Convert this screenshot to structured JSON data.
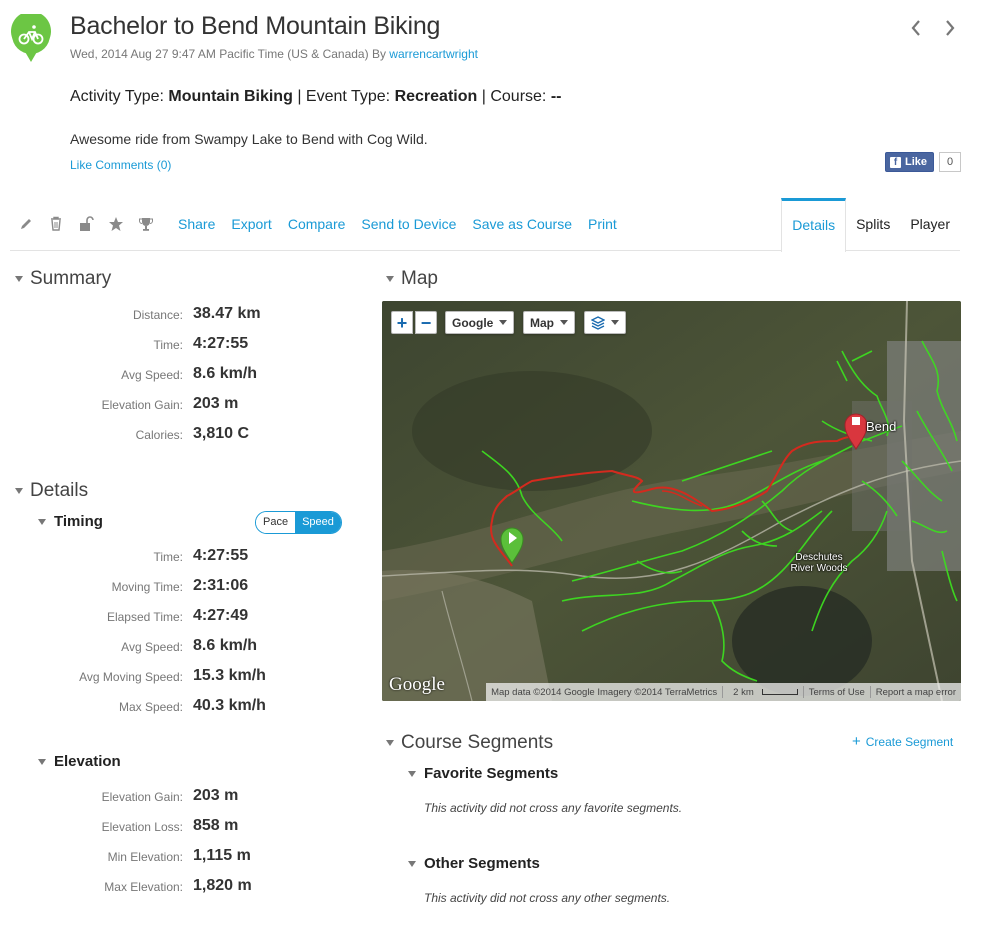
{
  "header": {
    "title": "Bachelor to Bend Mountain Biking",
    "date": "Wed, 2014 Aug 27 9:47 AM Pacific Time (US & Canada) By",
    "user": "warrencartwright",
    "activity_label": "Activity Type:",
    "activity_type": "Mountain Biking",
    "event_label": "| Event Type:",
    "event_type": "Recreation",
    "course_label": "| Course:",
    "course_value": "--",
    "description": "Awesome ride from Swampy Lake to Bend with Cog Wild.",
    "like": "Like",
    "comments": "Comments (0)",
    "accent_color": "#6cc644"
  },
  "facebook": {
    "like_label": "Like",
    "count": "0",
    "icon": "f"
  },
  "toolbar": {
    "icons": [
      "pencil-icon",
      "trash-icon",
      "lock-icon",
      "star-icon",
      "trophy-icon"
    ],
    "links": [
      "Share",
      "Export",
      "Compare",
      "Send to Device",
      "Save as Course",
      "Print"
    ],
    "tabs": [
      "Details",
      "Splits",
      "Player"
    ],
    "active_tab": "Details",
    "link_color": "#1a9ad6"
  },
  "summary": {
    "heading": "Summary",
    "stats": [
      {
        "label": "Distance:",
        "value": "38.47 km"
      },
      {
        "label": "Time:",
        "value": "4:27:55"
      },
      {
        "label": "Avg Speed:",
        "value": "8.6 km/h"
      },
      {
        "label": "Elevation Gain:",
        "value": "203 m"
      },
      {
        "label": "Calories:",
        "value": "3,810 C"
      }
    ]
  },
  "details": {
    "heading": "Details",
    "timing": {
      "heading": "Timing",
      "toggle": {
        "pace": "Pace",
        "speed": "Speed",
        "selected": "Speed"
      },
      "stats": [
        {
          "label": "Time:",
          "value": "4:27:55"
        },
        {
          "label": "Moving Time:",
          "value": "2:31:06"
        },
        {
          "label": "Elapsed Time:",
          "value": "4:27:49"
        },
        {
          "label": "Avg Speed:",
          "value": "8.6 km/h"
        },
        {
          "label": "Avg Moving Speed:",
          "value": "15.3 km/h"
        },
        {
          "label": "Max Speed:",
          "value": "40.3 km/h"
        }
      ]
    },
    "elevation": {
      "heading": "Elevation",
      "stats": [
        {
          "label": "Elevation Gain:",
          "value": "203 m"
        },
        {
          "label": "Elevation Loss:",
          "value": "858 m"
        },
        {
          "label": "Min Elevation:",
          "value": "1,115 m"
        },
        {
          "label": "Max Elevation:",
          "value": "1,820 m"
        }
      ]
    }
  },
  "map": {
    "heading": "Map",
    "zoom_in": "+",
    "zoom_out": "−",
    "provider": "Google",
    "map_type": "Map",
    "city_label": "Bend",
    "place_label_1": "Deschutes",
    "place_label_2": "River Woods",
    "logo": "Google",
    "attribution": "Map data ©2014 Google Imagery ©2014 TerraMetrics",
    "scale": "2 km",
    "terms": "Terms of Use",
    "report": "Report a map error",
    "route_color": "#d42a1e",
    "trail_color": "#3ddc20"
  },
  "segments": {
    "heading": "Course Segments",
    "create": "Create Segment",
    "favorite": {
      "heading": "Favorite Segments",
      "note": "This activity did not cross any favorite segments."
    },
    "other": {
      "heading": "Other Segments",
      "note": "This activity did not cross any other segments."
    }
  }
}
